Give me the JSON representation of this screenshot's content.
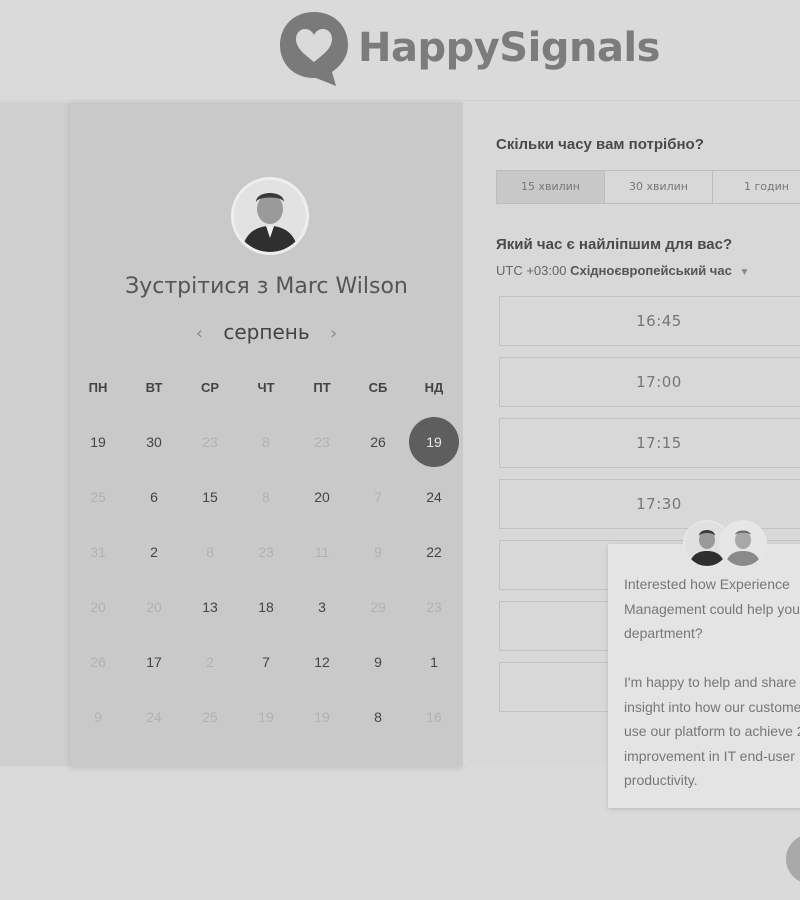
{
  "brand": {
    "name": "HappySignals"
  },
  "calendar": {
    "title": "Зустрітися з Marc Wilson",
    "month": "серпень",
    "prev_label": "‹",
    "next_label": "›",
    "weekdays": [
      "ПН",
      "ВТ",
      "СР",
      "ЧТ",
      "ПТ",
      "СБ",
      "НД"
    ],
    "weeks": [
      [
        {
          "d": "19",
          "m": false
        },
        {
          "d": "30",
          "m": false
        },
        {
          "d": "23",
          "m": true
        },
        {
          "d": "8",
          "m": true
        },
        {
          "d": "23",
          "m": true
        },
        {
          "d": "26",
          "m": false
        },
        {
          "d": "19",
          "m": false,
          "sel": true
        }
      ],
      [
        {
          "d": "25",
          "m": true
        },
        {
          "d": "6",
          "m": false
        },
        {
          "d": "15",
          "m": false
        },
        {
          "d": "8",
          "m": true
        },
        {
          "d": "20",
          "m": false
        },
        {
          "d": "7",
          "m": true
        },
        {
          "d": "24",
          "m": false
        }
      ],
      [
        {
          "d": "31",
          "m": true
        },
        {
          "d": "2",
          "m": false
        },
        {
          "d": "8",
          "m": true
        },
        {
          "d": "23",
          "m": true
        },
        {
          "d": "11",
          "m": true
        },
        {
          "d": "9",
          "m": true
        },
        {
          "d": "22",
          "m": false
        }
      ],
      [
        {
          "d": "20",
          "m": true
        },
        {
          "d": "20",
          "m": true
        },
        {
          "d": "13",
          "m": false
        },
        {
          "d": "18",
          "m": false
        },
        {
          "d": "3",
          "m": false
        },
        {
          "d": "29",
          "m": true
        },
        {
          "d": "23",
          "m": true
        }
      ],
      [
        {
          "d": "26",
          "m": true
        },
        {
          "d": "17",
          "m": false
        },
        {
          "d": "2",
          "m": true
        },
        {
          "d": "7",
          "m": false
        },
        {
          "d": "12",
          "m": false
        },
        {
          "d": "9",
          "m": false
        },
        {
          "d": "1",
          "m": false
        }
      ],
      [
        {
          "d": "9",
          "m": true
        },
        {
          "d": "24",
          "m": true
        },
        {
          "d": "25",
          "m": true
        },
        {
          "d": "19",
          "m": true
        },
        {
          "d": "19",
          "m": true
        },
        {
          "d": "8",
          "m": false
        },
        {
          "d": "16",
          "m": true
        }
      ]
    ]
  },
  "booking": {
    "duration_question": "Скільки часу вам потрібно?",
    "durations": [
      "15 хвилин",
      "30 хвилин",
      "1 годин"
    ],
    "active_duration": "15 хвилин",
    "time_question": "Який час є найліпшим для вас?",
    "tz_offset": "UTC +03:00",
    "tz_name": "Східноєвропейський час",
    "slots": [
      "16:45",
      "17:00",
      "17:15",
      "17:30",
      "",
      "",
      "",
      ""
    ]
  },
  "chat": {
    "message": "Interested how Experience Management could help your department?\n\nI'm happy to help and share insight into how our customers use our platform to achieve 2 improvement in IT end-user productivity."
  }
}
